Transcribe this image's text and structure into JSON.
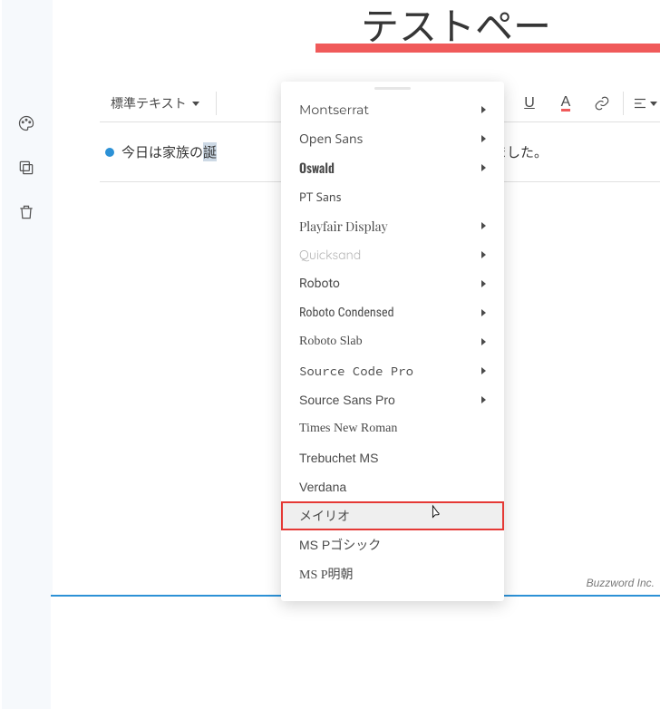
{
  "title_partial": "テストペー",
  "toolbar": {
    "style_label": "標準テキスト",
    "underline_glyph": "U",
    "fontcolor_glyph": "A"
  },
  "content": {
    "before": "今日は家族の",
    "selected": "誕",
    "after_menu": "出発しました。"
  },
  "font_menu": [
    {
      "label": "Montserrat",
      "submenu": true
    },
    {
      "label": "Open Sans",
      "submenu": true
    },
    {
      "label": "Oswald",
      "submenu": true
    },
    {
      "label": "PT Sans",
      "submenu": false
    },
    {
      "label": "Playfair Display",
      "submenu": true
    },
    {
      "label": "Quicksand",
      "submenu": true
    },
    {
      "label": "Roboto",
      "submenu": true
    },
    {
      "label": "Roboto Condensed",
      "submenu": true
    },
    {
      "label": "Roboto Slab",
      "submenu": true
    },
    {
      "label": "Source Code Pro",
      "submenu": true
    },
    {
      "label": "Source Sans Pro",
      "submenu": true
    },
    {
      "label": "Times New Roman",
      "submenu": false
    },
    {
      "label": "Trebuchet MS",
      "submenu": false
    },
    {
      "label": "Verdana",
      "submenu": false
    },
    {
      "label": "メイリオ",
      "submenu": false,
      "hover": true
    },
    {
      "label": "MS Pゴシック",
      "submenu": false
    },
    {
      "label": "MS P明朝",
      "submenu": false
    }
  ],
  "font_styles": [
    "font-family:'Montserrat',sans-serif;",
    "font-family:'Open Sans',sans-serif;",
    "font-family:'Oswald',sans-serif;font-weight:600;",
    "font-family:'PT Sans',sans-serif;",
    "font-family:'Playfair Display',serif;",
    "font-family:'Quicksand',sans-serif;color:#b5b5b5;",
    "font-family:'Roboto',sans-serif;",
    "font-family:'Roboto Condensed',sans-serif;font-stretch:condensed;",
    "font-family:'Roboto Slab',serif;",
    "font-family:'Source Code Pro',monospace;",
    "font-family:'Source Sans Pro',sans-serif;",
    "font-family:'Times New Roman',serif;",
    "font-family:'Trebuchet MS',sans-serif;",
    "font-family:Verdana,sans-serif;",
    "font-family:'Meiryo',sans-serif;",
    "font-family:'MS PGothic',sans-serif;",
    "font-family:'MS PMincho',serif;"
  ],
  "footer": "Buzzword Inc."
}
